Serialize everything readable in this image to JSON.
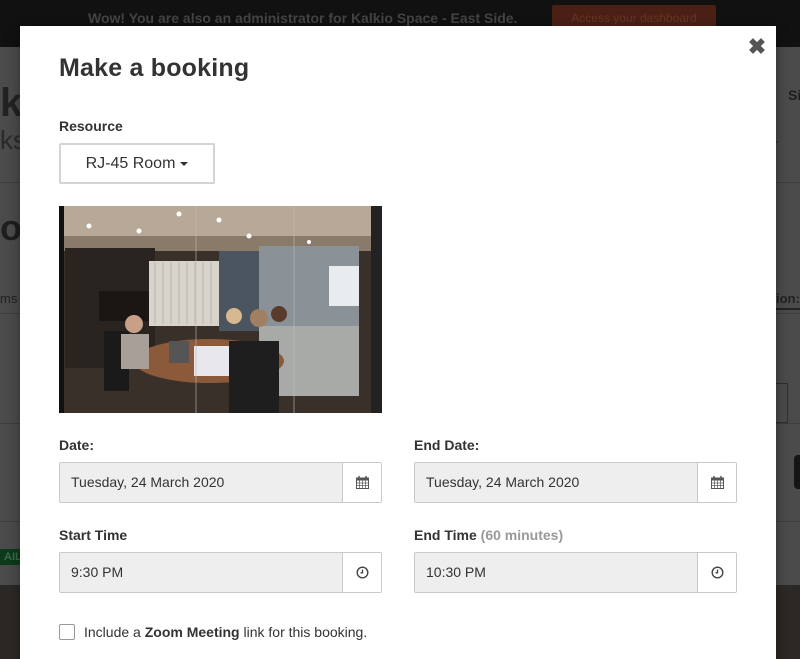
{
  "background": {
    "banner_message": "Wow! You are also an administrator for Kalkio Space - East Side.",
    "banner_cta": "Access your dashboard",
    "logo_fragment": "k",
    "logo_sub_fragment": "ks",
    "title_fragment": "o",
    "tab_left_fragment": "ms",
    "tab_right_fragment": "ion:",
    "nav_right_fragment": "Si",
    "badge_fragment": "AIL"
  },
  "modal": {
    "title": "Make a booking",
    "close_icon": "close-icon",
    "resource": {
      "label": "Resource",
      "selected": "RJ-45 Room",
      "icon": "caret-down-icon"
    },
    "image_alt": "Meeting room with people around a conference table",
    "date": {
      "label": "Date:",
      "value": "Tuesday, 24 March 2020",
      "icon": "calendar-icon"
    },
    "end_date": {
      "label": "End Date:",
      "value": "Tuesday, 24 March 2020",
      "icon": "calendar-icon"
    },
    "start_time": {
      "label": "Start Time",
      "value": "9:30 PM",
      "icon": "clock-icon"
    },
    "end_time": {
      "label": "End Time",
      "duration_note": "(60 minutes)",
      "value": "10:30 PM",
      "icon": "clock-icon"
    },
    "zoom_option": {
      "checked": false,
      "text_before": "Include a",
      "text_bold": "Zoom Meeting",
      "text_after": "link for this booking."
    }
  }
}
